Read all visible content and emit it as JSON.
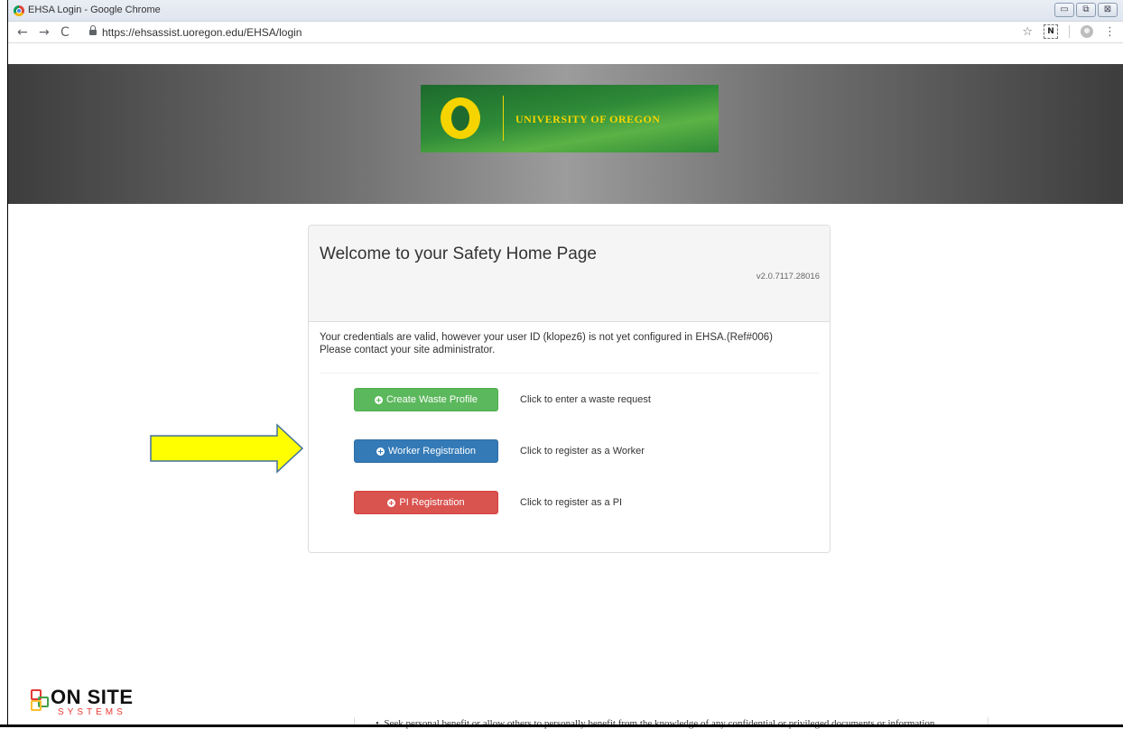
{
  "window": {
    "title": "EHSA Login - Google Chrome",
    "controls": [
      "▭",
      "⧉",
      "⊠"
    ]
  },
  "address_bar": {
    "url": "https://ehsassist.uoregon.edu/EHSA/login"
  },
  "banner": {
    "logo_text": "UNIVERSITY OF OREGON"
  },
  "panel": {
    "title": "Welcome to your Safety Home Page",
    "version": "v2.0.7117.28016",
    "message_line1": "Your credentials are valid, however your user ID (klopez6) is not yet configured in EHSA.(Ref#006)",
    "message_line2": "Please contact your site administrator.",
    "actions": [
      {
        "label": "Create Waste Profile",
        "hint": "Click to enter a waste request",
        "color": "#5cb85c"
      },
      {
        "label": "Worker Registration",
        "hint": "Click to register as a Worker",
        "color": "#337ab7"
      },
      {
        "label": "PI Registration",
        "hint": "Click to register as a PI",
        "color": "#d9534f"
      }
    ]
  },
  "annotation": {
    "arrow_color": "#ffff00"
  },
  "footer": {
    "brand_top": "ON SITE",
    "brand_bottom": "SYSTEMS",
    "cut_text": "Seek personal benefit or allow others to personally benefit from the knowledge of any confidential or privileged documents or information"
  }
}
